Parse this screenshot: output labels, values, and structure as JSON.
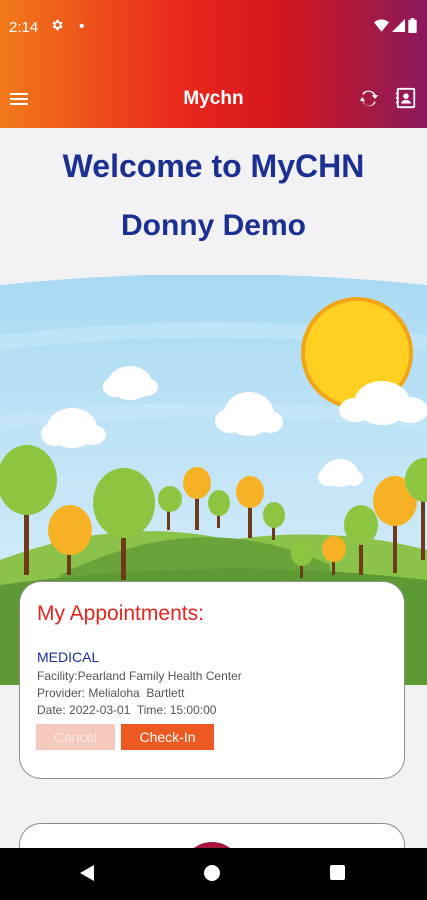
{
  "status_bar": {
    "time": "2:14",
    "icons": [
      "gear-icon",
      "dot-icon",
      "wifi-icon",
      "signal-icon",
      "battery-icon"
    ]
  },
  "app_bar": {
    "title": "Mychn",
    "icons": [
      "menu-icon",
      "refresh-icon",
      "contacts-icon"
    ]
  },
  "welcome": {
    "title": "Welcome to MyCHN",
    "user_name": "Donny Demo"
  },
  "appointments": {
    "heading": "My Appointments:",
    "items": [
      {
        "type": "MEDICAL",
        "facility": "Facility:Pearland Family Health Center",
        "provider": "Provider: Melialoha  Bartlett",
        "datetime": "Date: 2022-03-01  Time: 15:00:00",
        "cancel_label": "Cancel",
        "checkin_label": "Check-In"
      }
    ]
  },
  "colors": {
    "header_gradient_start": "#f27a1a",
    "header_gradient_end": "#8c1860",
    "title_blue": "#1c2f93",
    "heading_red": "#e0261f",
    "checkin_orange": "#ec5a22",
    "cancel_disabled": "#f5c9bd"
  },
  "nav_bar": {
    "icons": [
      "back-icon",
      "home-icon",
      "recents-icon"
    ]
  }
}
